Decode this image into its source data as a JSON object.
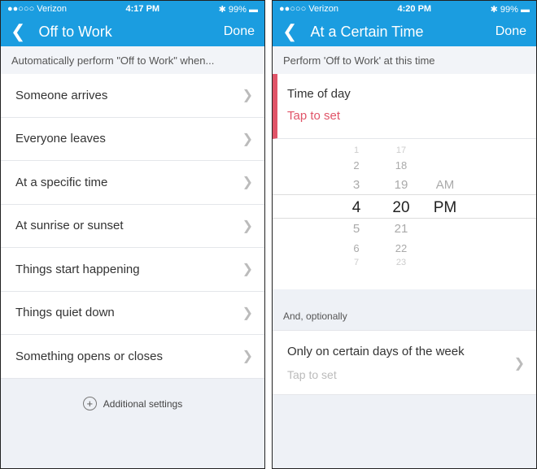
{
  "left": {
    "status": {
      "carrier": "●●○○○ Verizon",
      "time": "4:17 PM",
      "battery": "99%"
    },
    "nav": {
      "back": "<",
      "title": "Off to Work",
      "done": "Done"
    },
    "subheader": "Automatically perform \"Off to Work\" when...",
    "items": [
      "Someone arrives",
      "Everyone leaves",
      "At a specific time",
      "At sunrise or sunset",
      "Things start happening",
      "Things quiet down",
      "Something opens or closes"
    ],
    "additional": "Additional settings"
  },
  "right": {
    "status": {
      "carrier": "●●○○○ Verizon",
      "time": "4:20 PM",
      "battery": "99%"
    },
    "nav": {
      "back": "<",
      "title": "At a Certain Time",
      "done": "Done"
    },
    "subheader": "Perform 'Off to Work' at this time",
    "time_of_day": {
      "label": "Time of day",
      "value": "Tap to set"
    },
    "picker": {
      "hours": [
        "1",
        "2",
        "3",
        "4",
        "5",
        "6",
        "7"
      ],
      "minutes": [
        "17",
        "18",
        "19",
        "20",
        "21",
        "22",
        "23"
      ],
      "period": [
        "AM",
        "PM"
      ],
      "selected": {
        "hour": "4",
        "minute": "20",
        "period": "PM"
      }
    },
    "optional_header": "And, optionally",
    "days": {
      "label": "Only on certain days of the week",
      "value": "Tap to set"
    }
  },
  "colors": {
    "accent": "#1b9de0",
    "alert": "#e05468"
  }
}
